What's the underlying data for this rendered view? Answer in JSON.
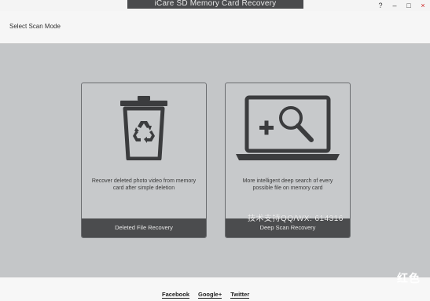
{
  "window": {
    "title": "iCare SD Memory Card Recovery",
    "controls": [
      "?",
      "–",
      "□",
      "×"
    ]
  },
  "header": {
    "title": "Select Scan Mode"
  },
  "cards": [
    {
      "icon": "recycle-bin-icon",
      "description": "Recover deleted photo video from memory card after simple deletion",
      "button_label": "Deleted File Recovery"
    },
    {
      "icon": "deep-scan-magnifier-icon",
      "description": "More intelligent deep search of every possible file on memory card",
      "button_label": "Deep Scan Recovery"
    }
  ],
  "watermark": "技术支持QQ/WX: 614316",
  "corner_mark": "红色",
  "footer": {
    "links": [
      "Facebook",
      "Google+",
      "Twitter"
    ]
  },
  "colors": {
    "title_tab": "#4a4b4d",
    "card_footer": "#4b4c4e",
    "main_background": "#c4c6c8"
  }
}
